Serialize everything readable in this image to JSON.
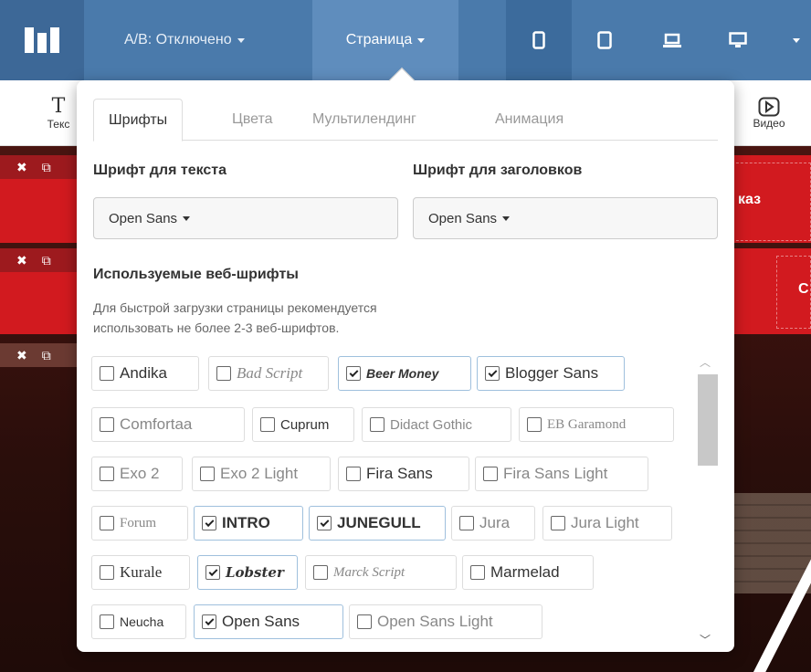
{
  "topbar": {
    "ab_label": "A/B: Отключено",
    "page_label": "Страница"
  },
  "toolbar": {
    "text_label": "Текс",
    "video_label": "Видео"
  },
  "canvas": {
    "order_label": "каз",
    "section_label": "C"
  },
  "popup": {
    "tabs": [
      {
        "label": "Шрифты",
        "active": true
      },
      {
        "label": "Цвета",
        "active": false
      },
      {
        "label": "Мультилендинг",
        "active": false
      },
      {
        "label": "Анимация",
        "active": false
      }
    ],
    "text_font_label": "Шрифт для текста",
    "text_font_value": "Open Sans",
    "heading_font_label": "Шрифт для заголовков",
    "heading_font_value": "Open Sans",
    "web_fonts_title": "Используемые веб-шрифты",
    "hint_line1": "Для быстрой загрузки страницы рекомендуется",
    "hint_line2": "использовать не более 2-3 веб-шрифтов.",
    "fonts": [
      [
        {
          "name": "Andika",
          "checked": false
        },
        {
          "name": "Bad Script",
          "checked": false
        },
        {
          "name": "Beer Money",
          "checked": true
        },
        {
          "name": "Blogger Sans",
          "checked": true
        }
      ],
      [
        {
          "name": "Comfortaa",
          "checked": false
        },
        {
          "name": "Cuprum",
          "checked": false
        },
        {
          "name": "Didact Gothic",
          "checked": false
        },
        {
          "name": "EB Garamond",
          "checked": false
        }
      ],
      [
        {
          "name": "Exo 2",
          "checked": false
        },
        {
          "name": "Exo 2 Light",
          "checked": false
        },
        {
          "name": "Fira Sans",
          "checked": false
        },
        {
          "name": "Fira Sans Light",
          "checked": false
        }
      ],
      [
        {
          "name": "Forum",
          "checked": false
        },
        {
          "name": "INTRO",
          "checked": true
        },
        {
          "name": "JUNEGULL",
          "checked": true
        },
        {
          "name": "Jura",
          "checked": false
        },
        {
          "name": "Jura Light",
          "checked": false
        }
      ],
      [
        {
          "name": "Kurale",
          "checked": false
        },
        {
          "name": "Lobster",
          "checked": true
        },
        {
          "name": "Marck Script",
          "checked": false
        },
        {
          "name": "Marmelad",
          "checked": false
        }
      ],
      [
        {
          "name": "Neucha",
          "checked": false
        },
        {
          "name": "Open Sans",
          "checked": true
        },
        {
          "name": "Open Sans Light",
          "checked": false
        }
      ]
    ]
  },
  "colors": {
    "topbar": "#4a7aab",
    "accent_red": "#d21a1f",
    "checked_border": "#9fc0dd"
  }
}
